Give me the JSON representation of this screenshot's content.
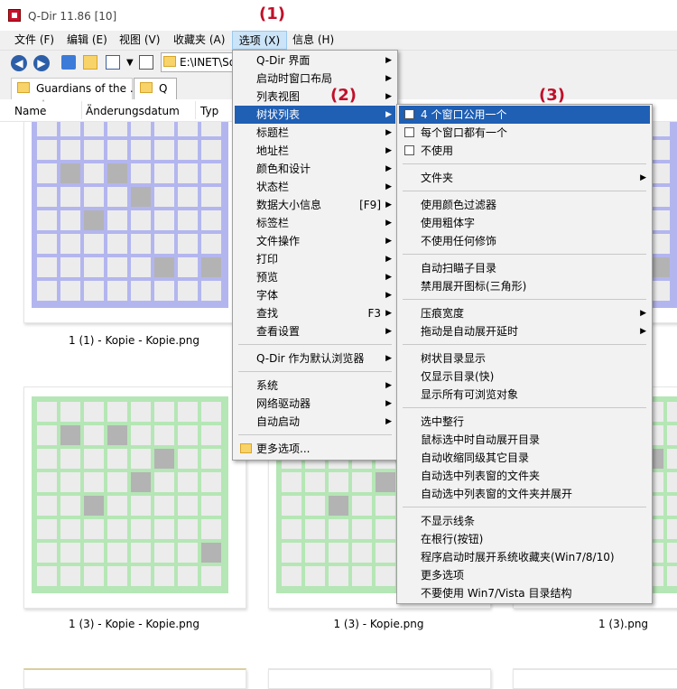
{
  "window": {
    "title": "Q-Dir 11.86 [10]"
  },
  "menubar": [
    {
      "label": "文件 (F)"
    },
    {
      "label": "编辑 (E)"
    },
    {
      "label": "视图 (V)"
    },
    {
      "label": "收藏夹 (A)"
    },
    {
      "label": "选项 (X)"
    },
    {
      "label": "信息 (H)"
    }
  ],
  "toolbar": {
    "back_icon": "arrow-left-icon",
    "forward_icon": "arrow-right-icon",
    "address": "E:\\INET\\So"
  },
  "tabs": [
    {
      "label": "Guardians of the ..."
    },
    {
      "label": "Q"
    }
  ],
  "columns": [
    {
      "label": "Name"
    },
    {
      "label": "Änderungsdatum"
    },
    {
      "label": "Typ"
    }
  ],
  "thumbnails": [
    {
      "label": "1 (1) - Kopie - Kopie.png",
      "color": "#b3b6ee"
    },
    {
      "label": "1 (3) - Kopie - Kopie.png",
      "color": "#b5e6b5"
    },
    {
      "label": "1 (3) - Kopie.png",
      "color": "#b5e6b5"
    },
    {
      "label": "1 (3).png",
      "color": "#b5e6b5"
    }
  ],
  "options_menu": [
    {
      "label": "Q-Dir 界面",
      "arrow": true
    },
    {
      "label": "启动时窗口布局",
      "arrow": true
    },
    {
      "label": "列表视图",
      "arrow": true
    },
    {
      "label": "树状列表",
      "arrow": true,
      "highlighted": true
    },
    {
      "label": "标题栏",
      "arrow": true
    },
    {
      "label": "地址栏",
      "arrow": true
    },
    {
      "label": "颜色和设计",
      "arrow": true
    },
    {
      "label": "状态栏",
      "arrow": true
    },
    {
      "label": "数据大小信息",
      "shortcut": "[F9]",
      "arrow": true
    },
    {
      "label": "标签栏",
      "arrow": true
    },
    {
      "label": "文件操作",
      "arrow": true
    },
    {
      "label": "打印",
      "arrow": true
    },
    {
      "label": "预览",
      "arrow": true
    },
    {
      "label": "字体",
      "arrow": true
    },
    {
      "label": "查找",
      "shortcut": "F3",
      "arrow": true
    },
    {
      "label": "查看设置",
      "arrow": true
    },
    {
      "separator": true
    },
    {
      "label": "Q-Dir 作为默认浏览器",
      "arrow": true
    },
    {
      "separator": true
    },
    {
      "label": "系统",
      "arrow": true
    },
    {
      "label": "网络驱动器",
      "arrow": true
    },
    {
      "label": "自动启动",
      "arrow": true
    },
    {
      "separator": true
    },
    {
      "label": "更多选项...",
      "icon": "folder-icon"
    }
  ],
  "tree_submenu": [
    {
      "label": "4 个窗口公用一个",
      "icon": "single-tree-icon",
      "highlighted": true
    },
    {
      "label": "每个窗口都有一个",
      "icon": "multi-tree-icon"
    },
    {
      "label": "不使用",
      "icon": "grid-icon"
    },
    {
      "separator": true
    },
    {
      "label": "文件夹",
      "arrow": true
    },
    {
      "separator": true
    },
    {
      "label": "使用颜色过滤器"
    },
    {
      "label": "使用粗体字"
    },
    {
      "label": "不使用任何修饰"
    },
    {
      "separator": true
    },
    {
      "label": "自动扫瞄子目录"
    },
    {
      "label": "禁用展开图标(三角形)"
    },
    {
      "separator": true
    },
    {
      "label": "压痕宽度",
      "arrow": true
    },
    {
      "label": "拖动是自动展开延时",
      "arrow": true
    },
    {
      "separator": true
    },
    {
      "label": "树状目录显示"
    },
    {
      "label": "仅显示目录(快)"
    },
    {
      "label": "显示所有可浏览对象"
    },
    {
      "separator": true
    },
    {
      "label": "选中整行"
    },
    {
      "label": "鼠标选中时自动展开目录"
    },
    {
      "label": "自动收缩同级其它目录"
    },
    {
      "label": "自动选中列表窗的文件夹"
    },
    {
      "label": "自动选中列表窗的文件夹并展开"
    },
    {
      "separator": true
    },
    {
      "label": "不显示线条"
    },
    {
      "label": "在根行(按钮)"
    },
    {
      "label": "程序启动时展开系统收藏夹(Win7/8/10)"
    },
    {
      "label": "更多选项"
    },
    {
      "label": "不要使用 Win7/Vista 目录结构"
    }
  ],
  "annotations": [
    {
      "label": "(1)"
    },
    {
      "label": "(2)"
    },
    {
      "label": "(3)"
    }
  ]
}
